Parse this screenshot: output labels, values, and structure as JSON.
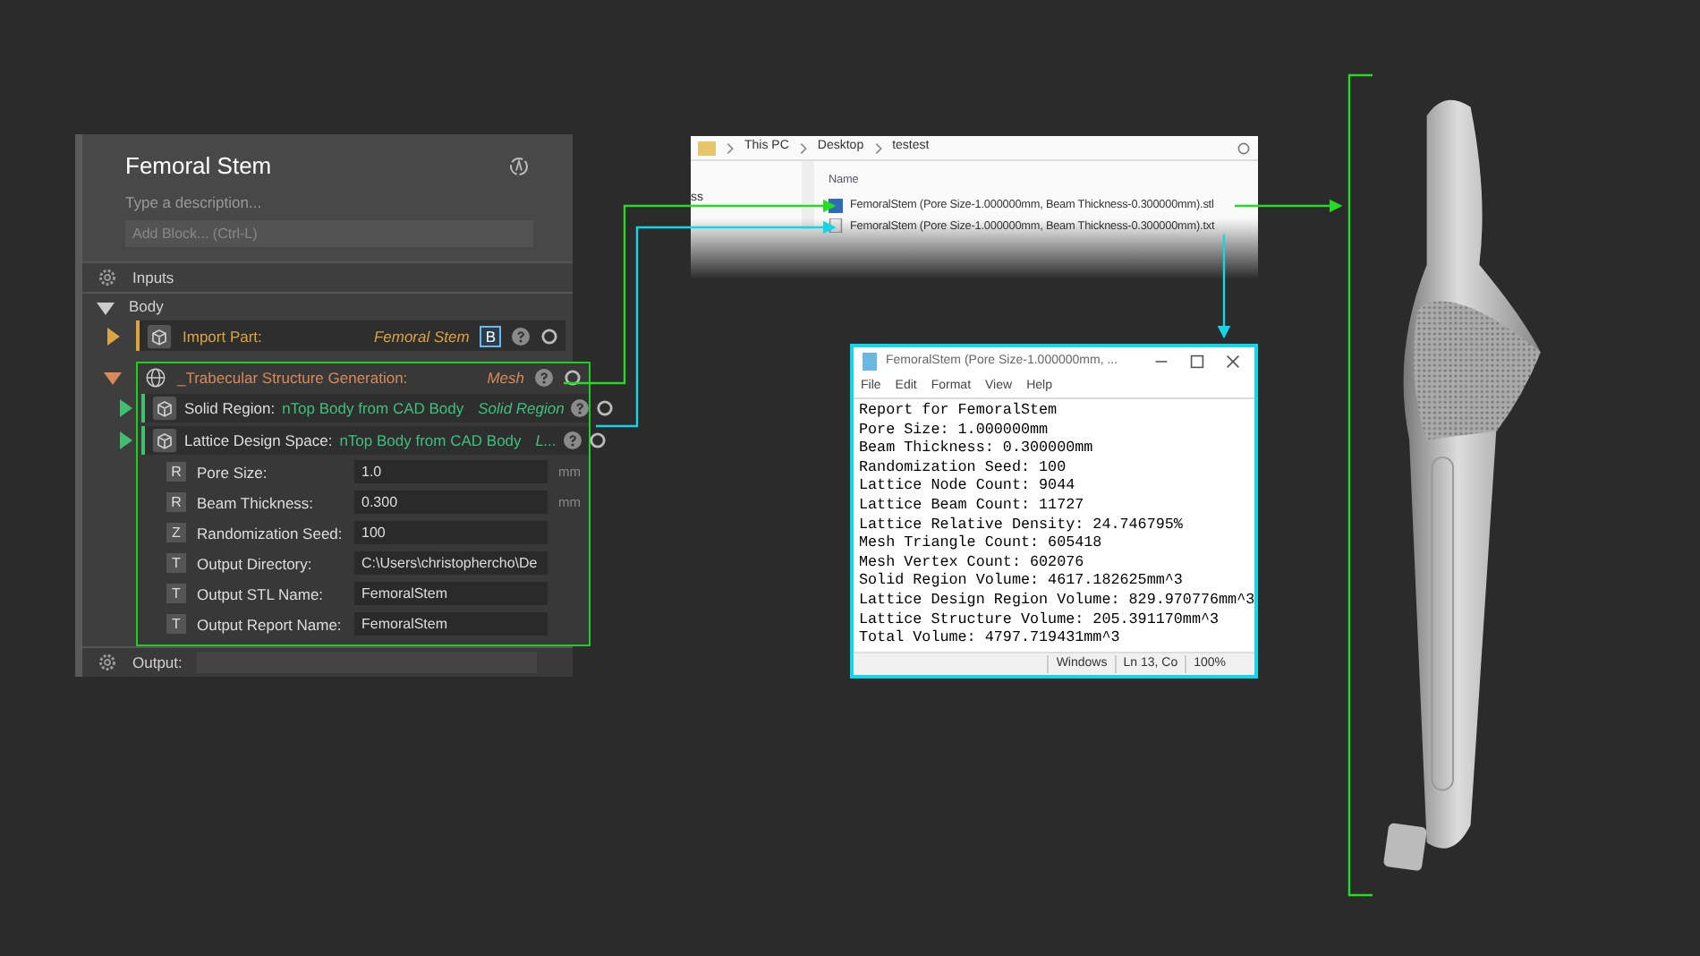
{
  "panel": {
    "title": "Femoral Stem",
    "description_placeholder": "Type a description...",
    "add_block_placeholder": "Add Block... (Ctrl-L)",
    "inputs_label": "Inputs",
    "body": {
      "label": "Body",
      "expanded": true
    },
    "import_block": {
      "label": "Import Part:",
      "value": "Femoral Stem",
      "badge": "B",
      "expanded": false
    },
    "trabecular_block": {
      "label": "_Trabecular Structure Generation:",
      "type": "Mesh",
      "expanded": true,
      "highlighted": true,
      "inputs": [
        {
          "kind": "body",
          "label": "Solid Region:",
          "value": "nTop Body from CAD Body",
          "type": "Solid Region",
          "expanded": false
        },
        {
          "kind": "body",
          "label": "Lattice Design Space:",
          "value": "nTop Body from CAD Body",
          "type": "L...",
          "expanded": false
        },
        {
          "kind": "param",
          "letter": "R",
          "label": "Pore Size:",
          "value": "1.0",
          "unit": "mm"
        },
        {
          "kind": "param",
          "letter": "R",
          "label": "Beam Thickness:",
          "value": "0.300",
          "unit": "mm"
        },
        {
          "kind": "param",
          "letter": "Z",
          "label": "Randomization Seed:",
          "value": "100"
        },
        {
          "kind": "param",
          "letter": "T",
          "label": "Output Directory:",
          "value": "C:\\Users\\christophercho\\De"
        },
        {
          "kind": "param",
          "letter": "T",
          "label": "Output STL Name:",
          "value": "FemoralStem"
        },
        {
          "kind": "param",
          "letter": "T",
          "label": "Output Report Name:",
          "value": "FemoralStem"
        }
      ]
    },
    "output_label": "Output:"
  },
  "explorer": {
    "breadcrumb": [
      "This PC",
      "Desktop",
      "testest"
    ],
    "nav_fragment": "ss",
    "column": "Name",
    "files": [
      {
        "kind": "stl",
        "name": "FemoralStem (Pore Size-1.000000mm, Beam Thickness-0.300000mm).stl"
      },
      {
        "kind": "txt",
        "name": "FemoralStem (Pore Size-1.000000mm, Beam Thickness-0.300000mm).txt"
      }
    ]
  },
  "notepad": {
    "title": "FemoralStem (Pore Size-1.000000mm, ...",
    "menu": [
      "File",
      "Edit",
      "Format",
      "View",
      "Help"
    ],
    "lines": [
      "Report for FemoralStem",
      "Pore Size: 1.000000mm",
      "Beam Thickness: 0.300000mm",
      "Randomization Seed: 100",
      "Lattice Node Count: 9044",
      "Lattice Beam Count: 11727",
      "Lattice Relative Density: 24.746795%",
      "Mesh Triangle Count: 605418",
      "Mesh Vertex Count: 602076",
      "Solid Region Volume: 4617.182625mm^3",
      "Lattice Design Region Volume: 829.970776mm^3",
      "Lattice Structure Volume: 205.391170mm^3",
      "Total Volume: 4797.719431mm^3"
    ],
    "status": [
      "Windows",
      "Ln 13, Co",
      "100%"
    ]
  }
}
